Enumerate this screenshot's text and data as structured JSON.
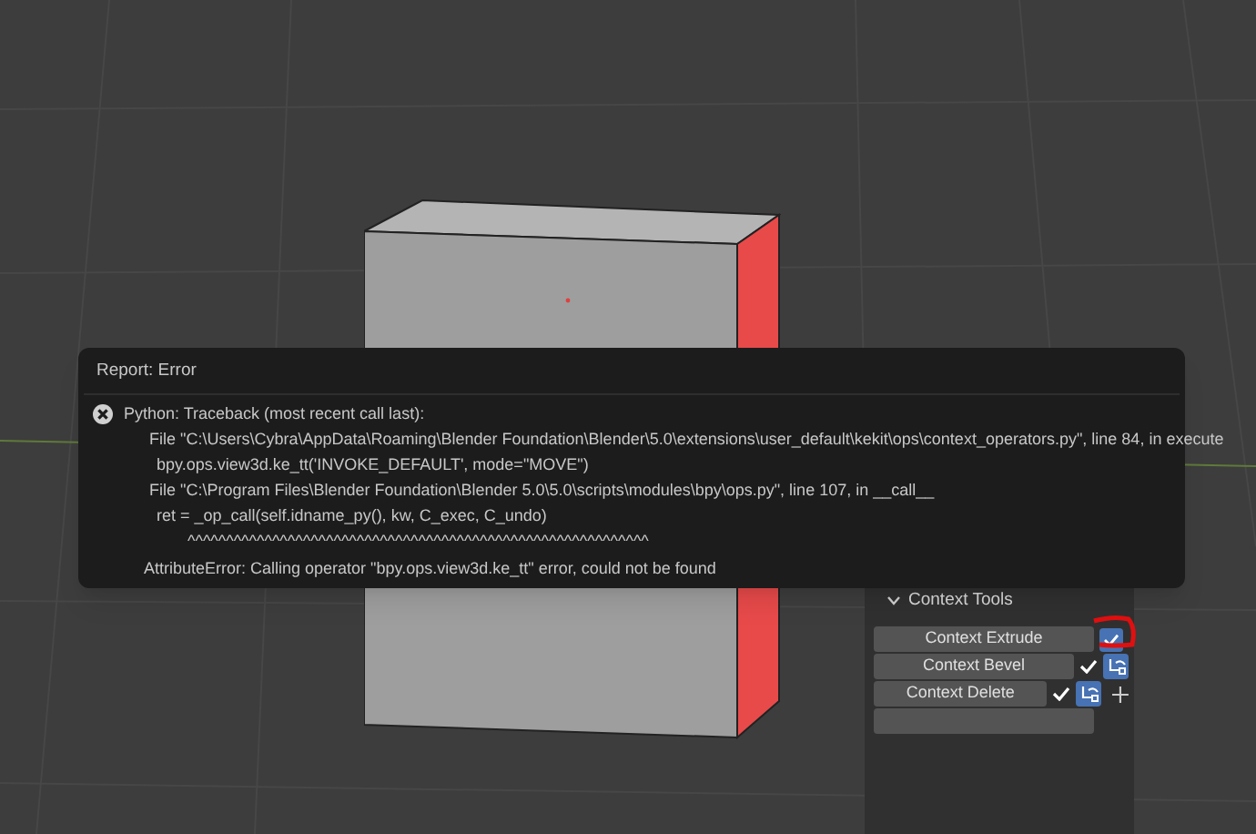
{
  "report": {
    "title": "Report: Error",
    "lines": [
      {
        "kind": "header",
        "text": "Python: Traceback (most recent call last):"
      },
      {
        "kind": "file",
        "text": "File \"C:\\Users\\Cybra\\AppData\\Roaming\\Blender Foundation\\Blender\\5.0\\extensions\\user_default\\kekit\\ops\\context_operators.py\", line 84, in execute"
      },
      {
        "kind": "code",
        "text": "bpy.ops.view3d.ke_tt('INVOKE_DEFAULT', mode=\"MOVE\")"
      },
      {
        "kind": "file",
        "text": "File \"C:\\Program Files\\Blender Foundation\\Blender 5.0\\5.0\\scripts\\modules\\bpy\\ops.py\", line 107, in __call__"
      },
      {
        "kind": "code",
        "text": "ret = _op_call(self.idname_py(), kw, C_exec, C_undo)"
      },
      {
        "kind": "code",
        "text": "^^^^^^^^^^^^^^^^^^^^^^^^^^^^^^^^^^^^^^^^^^^^^^^^^^^^^^^^^^^^"
      },
      {
        "kind": "error",
        "text": "AttributeError: Calling operator \"bpy.ops.view3d.ke_tt\" error, could not be found"
      }
    ]
  },
  "panel": {
    "title": "Context Tools",
    "expanded": true,
    "rows": [
      {
        "label": "Context Extrude",
        "kind": "checkbox",
        "checked": true
      },
      {
        "label": "Context Bevel",
        "kind": "tick-icon",
        "checked": true
      },
      {
        "label": "Context Delete",
        "kind": "tick-icon-plus",
        "checked": true
      }
    ]
  }
}
